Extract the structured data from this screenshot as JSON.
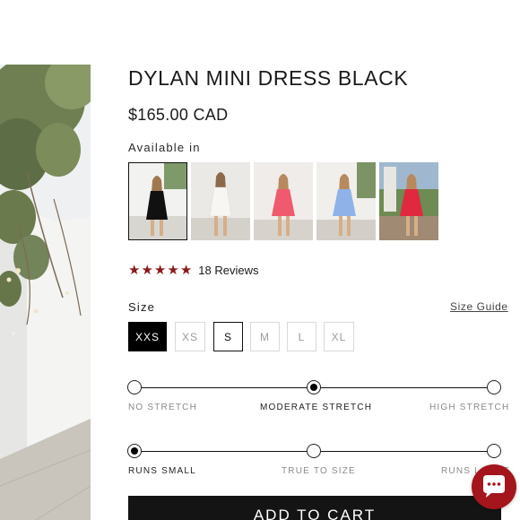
{
  "product": {
    "title": "DYLAN MINI DRESS BLACK",
    "price": "$165.00 CAD",
    "available_label": "Available in"
  },
  "colors": [
    {
      "name": "black",
      "hex": "#111111"
    },
    {
      "name": "white",
      "hex": "#f2f0ec"
    },
    {
      "name": "coral pink",
      "hex": "#ef5a6e"
    },
    {
      "name": "blue",
      "hex": "#8fb3e8"
    },
    {
      "name": "red",
      "hex": "#e0283f"
    }
  ],
  "rating": {
    "stars": 5,
    "reviews_text": "18 Reviews",
    "star_color": "#8b1a1a"
  },
  "size": {
    "label": "Size",
    "guide_label": "Size Guide",
    "options": [
      "XXS",
      "XS",
      "S",
      "M",
      "L",
      "XL"
    ],
    "selected": "XXS",
    "outlined": "S"
  },
  "stretch": {
    "labels": [
      "NO STRETCH",
      "MODERATE STRETCH",
      "HIGH STRETCH"
    ],
    "selected": "MODERATE STRETCH"
  },
  "fit": {
    "labels": [
      "RUNS SMALL",
      "TRUE TO SIZE",
      "RUNS LARGE"
    ],
    "selected": "RUNS SMALL"
  },
  "cart": {
    "label": "ADD TO CART"
  },
  "chat": {
    "icon": "chat-bubble-icon",
    "color": "#a4151c"
  }
}
